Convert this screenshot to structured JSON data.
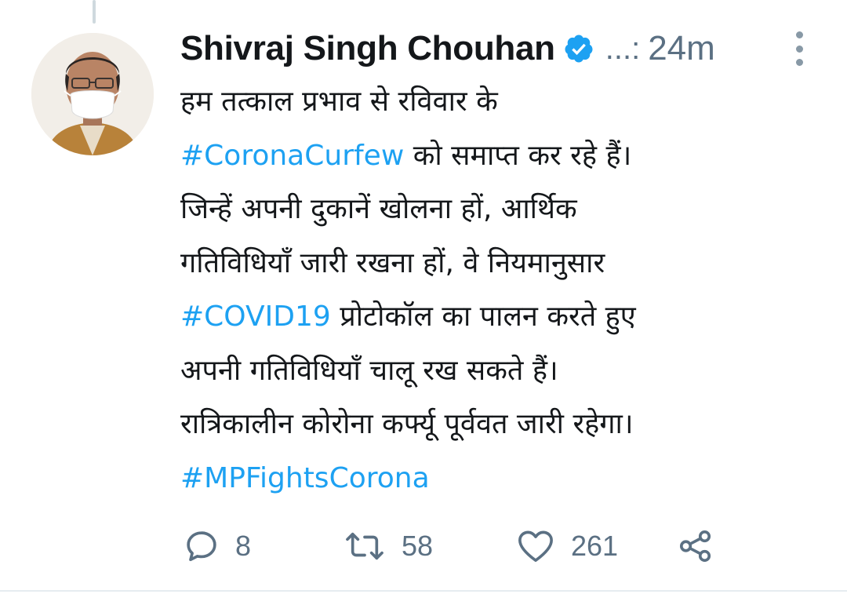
{
  "tweet": {
    "author": {
      "display_name": "Shivraj Singh Chouhan",
      "verified_icon": "verified-badge-icon",
      "handle_truncated": "...:",
      "timestamp": "24m"
    },
    "body_lines": [
      [
        {
          "text": "हम तत्काल प्रभाव से रविवार के",
          "hashtag": false
        }
      ],
      [
        {
          "text": "#CoronaCurfew",
          "hashtag": true
        },
        {
          "text": " को समाप्त कर रहे हैं।",
          "hashtag": false
        }
      ],
      [
        {
          "text": "जिन्हें अपनी दुकानें खोलना हों, आर्थिक",
          "hashtag": false
        }
      ],
      [
        {
          "text": "गतिविधियाँ जारी रखना हों, वे नियमानुसार",
          "hashtag": false
        }
      ],
      [
        {
          "text": "#COVID19",
          "hashtag": true
        },
        {
          "text": " प्रोटोकॉल का पालन करते हुए",
          "hashtag": false
        }
      ],
      [
        {
          "text": "अपनी गतिविधियाँ चालू रख सकते हैं।",
          "hashtag": false
        }
      ],
      [
        {
          "text": "रात्रिकालीन कोरोना कर्फ्यू पूर्ववत जारी रहेगा।",
          "hashtag": false
        }
      ],
      [
        {
          "text": "#MPFightsCorona",
          "hashtag": true
        }
      ]
    ],
    "actions": {
      "reply": {
        "icon": "reply-icon",
        "count": "8"
      },
      "retweet": {
        "icon": "retweet-icon",
        "count": "58"
      },
      "like": {
        "icon": "heart-icon",
        "count": "261"
      },
      "share": {
        "icon": "share-icon"
      }
    }
  },
  "colors": {
    "hashtag": "#1da1f2",
    "verified": "#1da1f2",
    "secondary_text": "#5b7083",
    "primary_text": "#14171a"
  }
}
